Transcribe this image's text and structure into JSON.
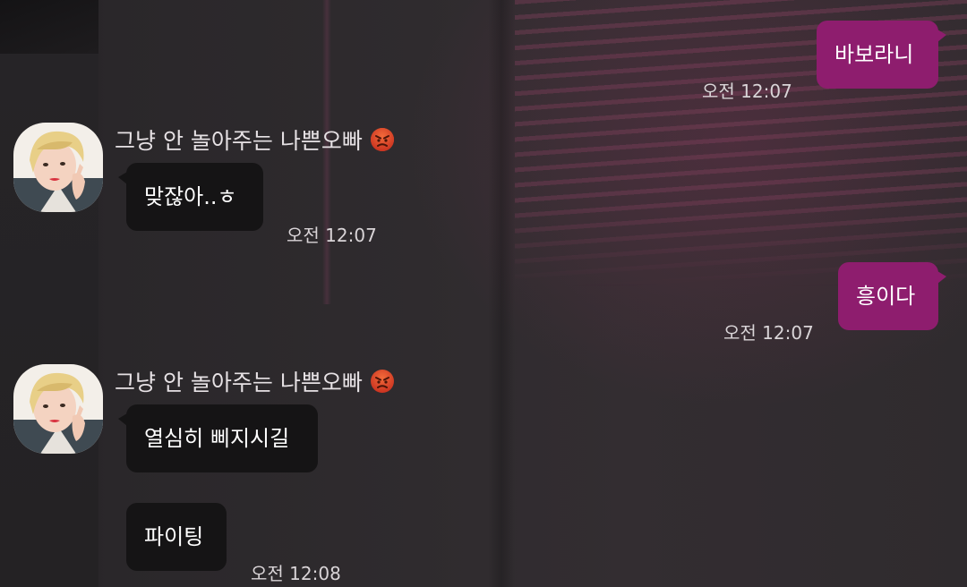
{
  "outgoing": [
    {
      "text": "바보라니",
      "time": "오전 12:07"
    },
    {
      "text": "흥이다",
      "time": "오전 12:07"
    }
  ],
  "incoming_groups": [
    {
      "sender": "그냥 안 놀아주는 나쁜오빠",
      "sender_emoji": "angry-face-icon",
      "messages": [
        "맞잖아..ㅎ"
      ],
      "time": "오전 12:07"
    },
    {
      "sender": "그냥 안 놀아주는 나쁜오빠",
      "sender_emoji": "angry-face-icon",
      "messages": [
        "열심히 삐지시길",
        "파이팅"
      ],
      "time": "오전 12:08"
    }
  ],
  "colors": {
    "outgoing_bubble": "#8e1d6e",
    "incoming_bubble": "#151415",
    "text": "#ffffff",
    "timestamp": "#d9d4d7"
  }
}
